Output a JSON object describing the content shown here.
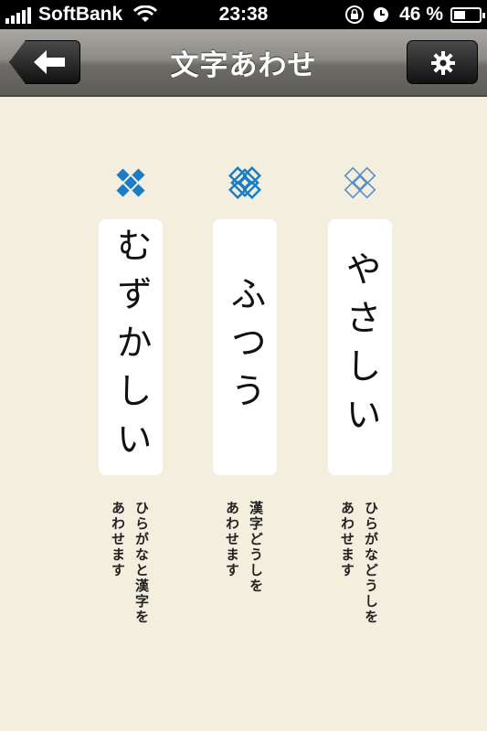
{
  "status": {
    "carrier": "SoftBank",
    "time": "23:38",
    "battery": "46 %",
    "battery_fraction": 0.46
  },
  "nav": {
    "title": "文字あわせ",
    "back_icon": "arrow-left-icon",
    "settings_icon": "gear-icon"
  },
  "levels": [
    {
      "label": "むずかしい",
      "desc": "ひらがなと漢字を\nあわせます",
      "icon": "diamond-solid-icon",
      "color": "#1a7ec4"
    },
    {
      "label": "ふつう",
      "desc": "漢字どうしを\nあわせます",
      "icon": "diamond-outline-icon",
      "color": "#1a7ec4"
    },
    {
      "label": "やさしい",
      "desc": "ひらがなどうしを\nあわせます",
      "icon": "diamond-light-icon",
      "color": "#5a8fc6"
    }
  ]
}
